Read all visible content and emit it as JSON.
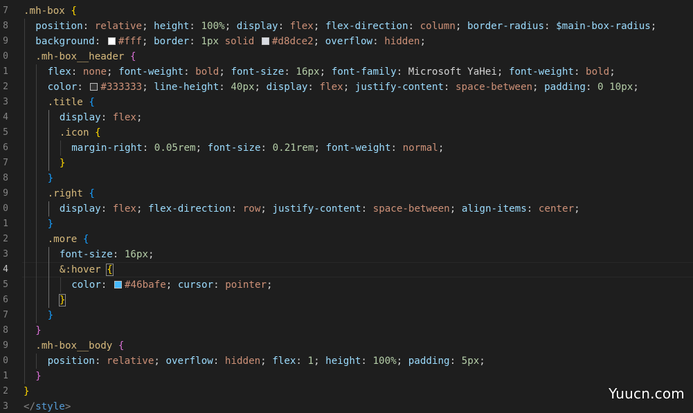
{
  "colors": {
    "background": "#1e1e1e",
    "selector": "#d7ba7d",
    "property": "#9cdcfe",
    "value_keyword": "#ce9178",
    "number": "#b5cea8",
    "punctuation": "#d4d4d4",
    "bracket_gold": "#ffd700",
    "bracket_pink": "#da70d6",
    "bracket_blue": "#179fff",
    "tag": "#569cd6",
    "line_number": "#858585",
    "swatch_white": "#ffffff",
    "swatch_border": "#d8dce2",
    "swatch_dark": "#333333",
    "swatch_blue": "#46bafe"
  },
  "line_numbers": [
    "7",
    "8",
    "9",
    "0",
    "1",
    "2",
    "3",
    "4",
    "5",
    "6",
    "7",
    "8",
    "9",
    "0",
    "1",
    "2",
    "3",
    "4",
    "5",
    "6",
    "7",
    "8",
    "9",
    "0",
    "1",
    "2",
    "3"
  ],
  "active_line_index": 17,
  "lines": [
    {
      "indent": 0,
      "tokens": [
        {
          "t": ".mh-box",
          "c": "selector"
        },
        {
          "t": " ",
          "c": "punctuation"
        },
        {
          "t": "{",
          "c": "bracket_gold"
        }
      ]
    },
    {
      "indent": 1,
      "tokens": [
        {
          "t": "position",
          "c": "property"
        },
        {
          "t": ": ",
          "c": "punctuation"
        },
        {
          "t": "relative",
          "c": "value_keyword"
        },
        {
          "t": "; ",
          "c": "punctuation"
        },
        {
          "t": "height",
          "c": "property"
        },
        {
          "t": ": ",
          "c": "punctuation"
        },
        {
          "t": "100%",
          "c": "number"
        },
        {
          "t": "; ",
          "c": "punctuation"
        },
        {
          "t": "display",
          "c": "property"
        },
        {
          "t": ": ",
          "c": "punctuation"
        },
        {
          "t": "flex",
          "c": "value_keyword"
        },
        {
          "t": "; ",
          "c": "punctuation"
        },
        {
          "t": "flex-direction",
          "c": "property"
        },
        {
          "t": ": ",
          "c": "punctuation"
        },
        {
          "t": "column",
          "c": "value_keyword"
        },
        {
          "t": "; ",
          "c": "punctuation"
        },
        {
          "t": "border-radius",
          "c": "property"
        },
        {
          "t": ": ",
          "c": "punctuation"
        },
        {
          "t": "$main-box-radius",
          "c": "property"
        },
        {
          "t": ";",
          "c": "punctuation"
        }
      ]
    },
    {
      "indent": 1,
      "tokens": [
        {
          "t": "background",
          "c": "property"
        },
        {
          "t": ": ",
          "c": "punctuation"
        },
        {
          "swatch": "swatch_white"
        },
        {
          "t": "#fff",
          "c": "value_keyword"
        },
        {
          "t": "; ",
          "c": "punctuation"
        },
        {
          "t": "border",
          "c": "property"
        },
        {
          "t": ": ",
          "c": "punctuation"
        },
        {
          "t": "1px",
          "c": "number"
        },
        {
          "t": " ",
          "c": "punctuation"
        },
        {
          "t": "solid",
          "c": "value_keyword"
        },
        {
          "t": " ",
          "c": "punctuation"
        },
        {
          "swatch": "swatch_border"
        },
        {
          "t": "#d8dce2",
          "c": "value_keyword"
        },
        {
          "t": "; ",
          "c": "punctuation"
        },
        {
          "t": "overflow",
          "c": "property"
        },
        {
          "t": ": ",
          "c": "punctuation"
        },
        {
          "t": "hidden",
          "c": "value_keyword"
        },
        {
          "t": ";",
          "c": "punctuation"
        }
      ]
    },
    {
      "indent": 1,
      "tokens": [
        {
          "t": ".mh-box__header",
          "c": "selector"
        },
        {
          "t": " ",
          "c": "punctuation"
        },
        {
          "t": "{",
          "c": "bracket_pink"
        }
      ]
    },
    {
      "indent": 2,
      "tokens": [
        {
          "t": "flex",
          "c": "property"
        },
        {
          "t": ": ",
          "c": "punctuation"
        },
        {
          "t": "none",
          "c": "value_keyword"
        },
        {
          "t": "; ",
          "c": "punctuation"
        },
        {
          "t": "font-weight",
          "c": "property"
        },
        {
          "t": ": ",
          "c": "punctuation"
        },
        {
          "t": "bold",
          "c": "value_keyword"
        },
        {
          "t": "; ",
          "c": "punctuation"
        },
        {
          "t": "font-size",
          "c": "property"
        },
        {
          "t": ": ",
          "c": "punctuation"
        },
        {
          "t": "16px",
          "c": "number"
        },
        {
          "t": "; ",
          "c": "punctuation"
        },
        {
          "t": "font-family",
          "c": "property"
        },
        {
          "t": ": ",
          "c": "punctuation"
        },
        {
          "t": "Microsoft YaHei",
          "c": "punctuation"
        },
        {
          "t": "; ",
          "c": "punctuation"
        },
        {
          "t": "font-weight",
          "c": "property"
        },
        {
          "t": ": ",
          "c": "punctuation"
        },
        {
          "t": "bold",
          "c": "value_keyword"
        },
        {
          "t": ";",
          "c": "punctuation"
        }
      ]
    },
    {
      "indent": 2,
      "tokens": [
        {
          "t": "color",
          "c": "property"
        },
        {
          "t": ": ",
          "c": "punctuation"
        },
        {
          "swatch": "swatch_dark"
        },
        {
          "t": "#333333",
          "c": "value_keyword"
        },
        {
          "t": "; ",
          "c": "punctuation"
        },
        {
          "t": "line-height",
          "c": "property"
        },
        {
          "t": ": ",
          "c": "punctuation"
        },
        {
          "t": "40px",
          "c": "number"
        },
        {
          "t": "; ",
          "c": "punctuation"
        },
        {
          "t": "display",
          "c": "property"
        },
        {
          "t": ": ",
          "c": "punctuation"
        },
        {
          "t": "flex",
          "c": "value_keyword"
        },
        {
          "t": "; ",
          "c": "punctuation"
        },
        {
          "t": "justify-content",
          "c": "property"
        },
        {
          "t": ": ",
          "c": "punctuation"
        },
        {
          "t": "space-between",
          "c": "value_keyword"
        },
        {
          "t": "; ",
          "c": "punctuation"
        },
        {
          "t": "padding",
          "c": "property"
        },
        {
          "t": ": ",
          "c": "punctuation"
        },
        {
          "t": "0",
          "c": "number"
        },
        {
          "t": " ",
          "c": "punctuation"
        },
        {
          "t": "10px",
          "c": "number"
        },
        {
          "t": ";",
          "c": "punctuation"
        }
      ]
    },
    {
      "indent": 2,
      "tokens": [
        {
          "t": ".title",
          "c": "selector"
        },
        {
          "t": " ",
          "c": "punctuation"
        },
        {
          "t": "{",
          "c": "bracket_blue"
        }
      ]
    },
    {
      "indent": 3,
      "tokens": [
        {
          "t": "display",
          "c": "property"
        },
        {
          "t": ": ",
          "c": "punctuation"
        },
        {
          "t": "flex",
          "c": "value_keyword"
        },
        {
          "t": ";",
          "c": "punctuation"
        }
      ]
    },
    {
      "indent": 3,
      "tokens": [
        {
          "t": ".icon",
          "c": "selector"
        },
        {
          "t": " ",
          "c": "punctuation"
        },
        {
          "t": "{",
          "c": "bracket_gold"
        }
      ]
    },
    {
      "indent": 4,
      "tokens": [
        {
          "t": "margin-right",
          "c": "property"
        },
        {
          "t": ": ",
          "c": "punctuation"
        },
        {
          "t": "0.05rem",
          "c": "number"
        },
        {
          "t": "; ",
          "c": "punctuation"
        },
        {
          "t": "font-size",
          "c": "property"
        },
        {
          "t": ": ",
          "c": "punctuation"
        },
        {
          "t": "0.21rem",
          "c": "number"
        },
        {
          "t": "; ",
          "c": "punctuation"
        },
        {
          "t": "font-weight",
          "c": "property"
        },
        {
          "t": ": ",
          "c": "punctuation"
        },
        {
          "t": "normal",
          "c": "value_keyword"
        },
        {
          "t": ";",
          "c": "punctuation"
        }
      ]
    },
    {
      "indent": 3,
      "tokens": [
        {
          "t": "}",
          "c": "bracket_gold"
        }
      ]
    },
    {
      "indent": 2,
      "tokens": [
        {
          "t": "}",
          "c": "bracket_blue"
        }
      ]
    },
    {
      "indent": 2,
      "tokens": [
        {
          "t": ".right",
          "c": "selector"
        },
        {
          "t": " ",
          "c": "punctuation"
        },
        {
          "t": "{",
          "c": "bracket_blue"
        }
      ]
    },
    {
      "indent": 3,
      "tokens": [
        {
          "t": "display",
          "c": "property"
        },
        {
          "t": ": ",
          "c": "punctuation"
        },
        {
          "t": "flex",
          "c": "value_keyword"
        },
        {
          "t": "; ",
          "c": "punctuation"
        },
        {
          "t": "flex-direction",
          "c": "property"
        },
        {
          "t": ": ",
          "c": "punctuation"
        },
        {
          "t": "row",
          "c": "value_keyword"
        },
        {
          "t": "; ",
          "c": "punctuation"
        },
        {
          "t": "justify-content",
          "c": "property"
        },
        {
          "t": ": ",
          "c": "punctuation"
        },
        {
          "t": "space-between",
          "c": "value_keyword"
        },
        {
          "t": "; ",
          "c": "punctuation"
        },
        {
          "t": "align-items",
          "c": "property"
        },
        {
          "t": ": ",
          "c": "punctuation"
        },
        {
          "t": "center",
          "c": "value_keyword"
        },
        {
          "t": ";",
          "c": "punctuation"
        }
      ]
    },
    {
      "indent": 2,
      "tokens": [
        {
          "t": "}",
          "c": "bracket_blue"
        }
      ]
    },
    {
      "indent": 2,
      "tokens": [
        {
          "t": ".more",
          "c": "selector"
        },
        {
          "t": " ",
          "c": "punctuation"
        },
        {
          "t": "{",
          "c": "bracket_blue"
        }
      ]
    },
    {
      "indent": 3,
      "tokens": [
        {
          "t": "font-size",
          "c": "property"
        },
        {
          "t": ": ",
          "c": "punctuation"
        },
        {
          "t": "16px",
          "c": "number"
        },
        {
          "t": ";",
          "c": "punctuation"
        }
      ]
    },
    {
      "indent": 3,
      "current": true,
      "tokens": [
        {
          "t": "&:hover",
          "c": "selector"
        },
        {
          "t": " ",
          "c": "punctuation"
        },
        {
          "t": "{",
          "c": "bracket_gold",
          "box": true
        }
      ]
    },
    {
      "indent": 4,
      "tokens": [
        {
          "t": "color",
          "c": "property"
        },
        {
          "t": ": ",
          "c": "punctuation"
        },
        {
          "swatch": "swatch_blue"
        },
        {
          "t": "#46bafe",
          "c": "value_keyword"
        },
        {
          "t": "; ",
          "c": "punctuation"
        },
        {
          "t": "cursor",
          "c": "property"
        },
        {
          "t": ": ",
          "c": "punctuation"
        },
        {
          "t": "pointer",
          "c": "value_keyword"
        },
        {
          "t": ";",
          "c": "punctuation"
        }
      ]
    },
    {
      "indent": 3,
      "tokens": [
        {
          "t": "}",
          "c": "bracket_gold",
          "box": true
        }
      ]
    },
    {
      "indent": 2,
      "tokens": [
        {
          "t": "}",
          "c": "bracket_blue"
        }
      ]
    },
    {
      "indent": 1,
      "tokens": [
        {
          "t": "}",
          "c": "bracket_pink"
        }
      ]
    },
    {
      "indent": 1,
      "tokens": [
        {
          "t": ".mh-box__body",
          "c": "selector"
        },
        {
          "t": " ",
          "c": "punctuation"
        },
        {
          "t": "{",
          "c": "bracket_pink"
        }
      ]
    },
    {
      "indent": 2,
      "tokens": [
        {
          "t": "position",
          "c": "property"
        },
        {
          "t": ": ",
          "c": "punctuation"
        },
        {
          "t": "relative",
          "c": "value_keyword"
        },
        {
          "t": "; ",
          "c": "punctuation"
        },
        {
          "t": "overflow",
          "c": "property"
        },
        {
          "t": ": ",
          "c": "punctuation"
        },
        {
          "t": "hidden",
          "c": "value_keyword"
        },
        {
          "t": "; ",
          "c": "punctuation"
        },
        {
          "t": "flex",
          "c": "property"
        },
        {
          "t": ": ",
          "c": "punctuation"
        },
        {
          "t": "1",
          "c": "number"
        },
        {
          "t": "; ",
          "c": "punctuation"
        },
        {
          "t": "height",
          "c": "property"
        },
        {
          "t": ": ",
          "c": "punctuation"
        },
        {
          "t": "100%",
          "c": "number"
        },
        {
          "t": "; ",
          "c": "punctuation"
        },
        {
          "t": "padding",
          "c": "property"
        },
        {
          "t": ": ",
          "c": "punctuation"
        },
        {
          "t": "5px",
          "c": "number"
        },
        {
          "t": ";",
          "c": "punctuation"
        }
      ]
    },
    {
      "indent": 1,
      "tokens": [
        {
          "t": "}",
          "c": "bracket_pink"
        }
      ]
    },
    {
      "indent": 0,
      "tokens": [
        {
          "t": "}",
          "c": "bracket_gold"
        }
      ]
    },
    {
      "indent": 0,
      "tokens": [
        {
          "t": "</",
          "c": "line_number"
        },
        {
          "t": "style",
          "c": "tag"
        },
        {
          "t": ">",
          "c": "line_number"
        }
      ]
    }
  ],
  "watermark": "Yuucn.com"
}
